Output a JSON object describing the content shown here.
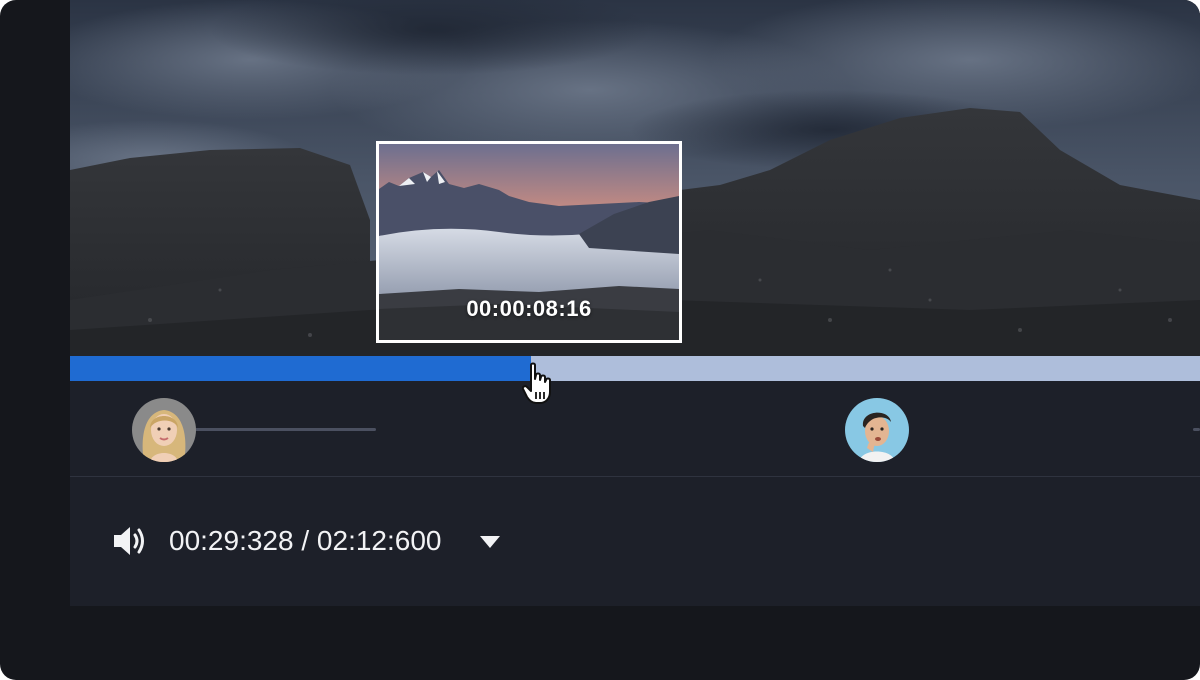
{
  "player": {
    "preview_timestamp": "00:00:08:16",
    "progress_fraction": 0.408,
    "current_time": "00:29:328",
    "time_separator": "/",
    "total_time": "02:12:600"
  },
  "colors": {
    "progress_played": "#1f6bd2",
    "progress_remaining": "#aebedb",
    "panel_background": "#1d2029",
    "frame_background": "#15171c"
  },
  "icons": {
    "volume": "volume-icon",
    "dropdown": "chevron-down-icon",
    "cursor": "hand-pointer-icon"
  }
}
